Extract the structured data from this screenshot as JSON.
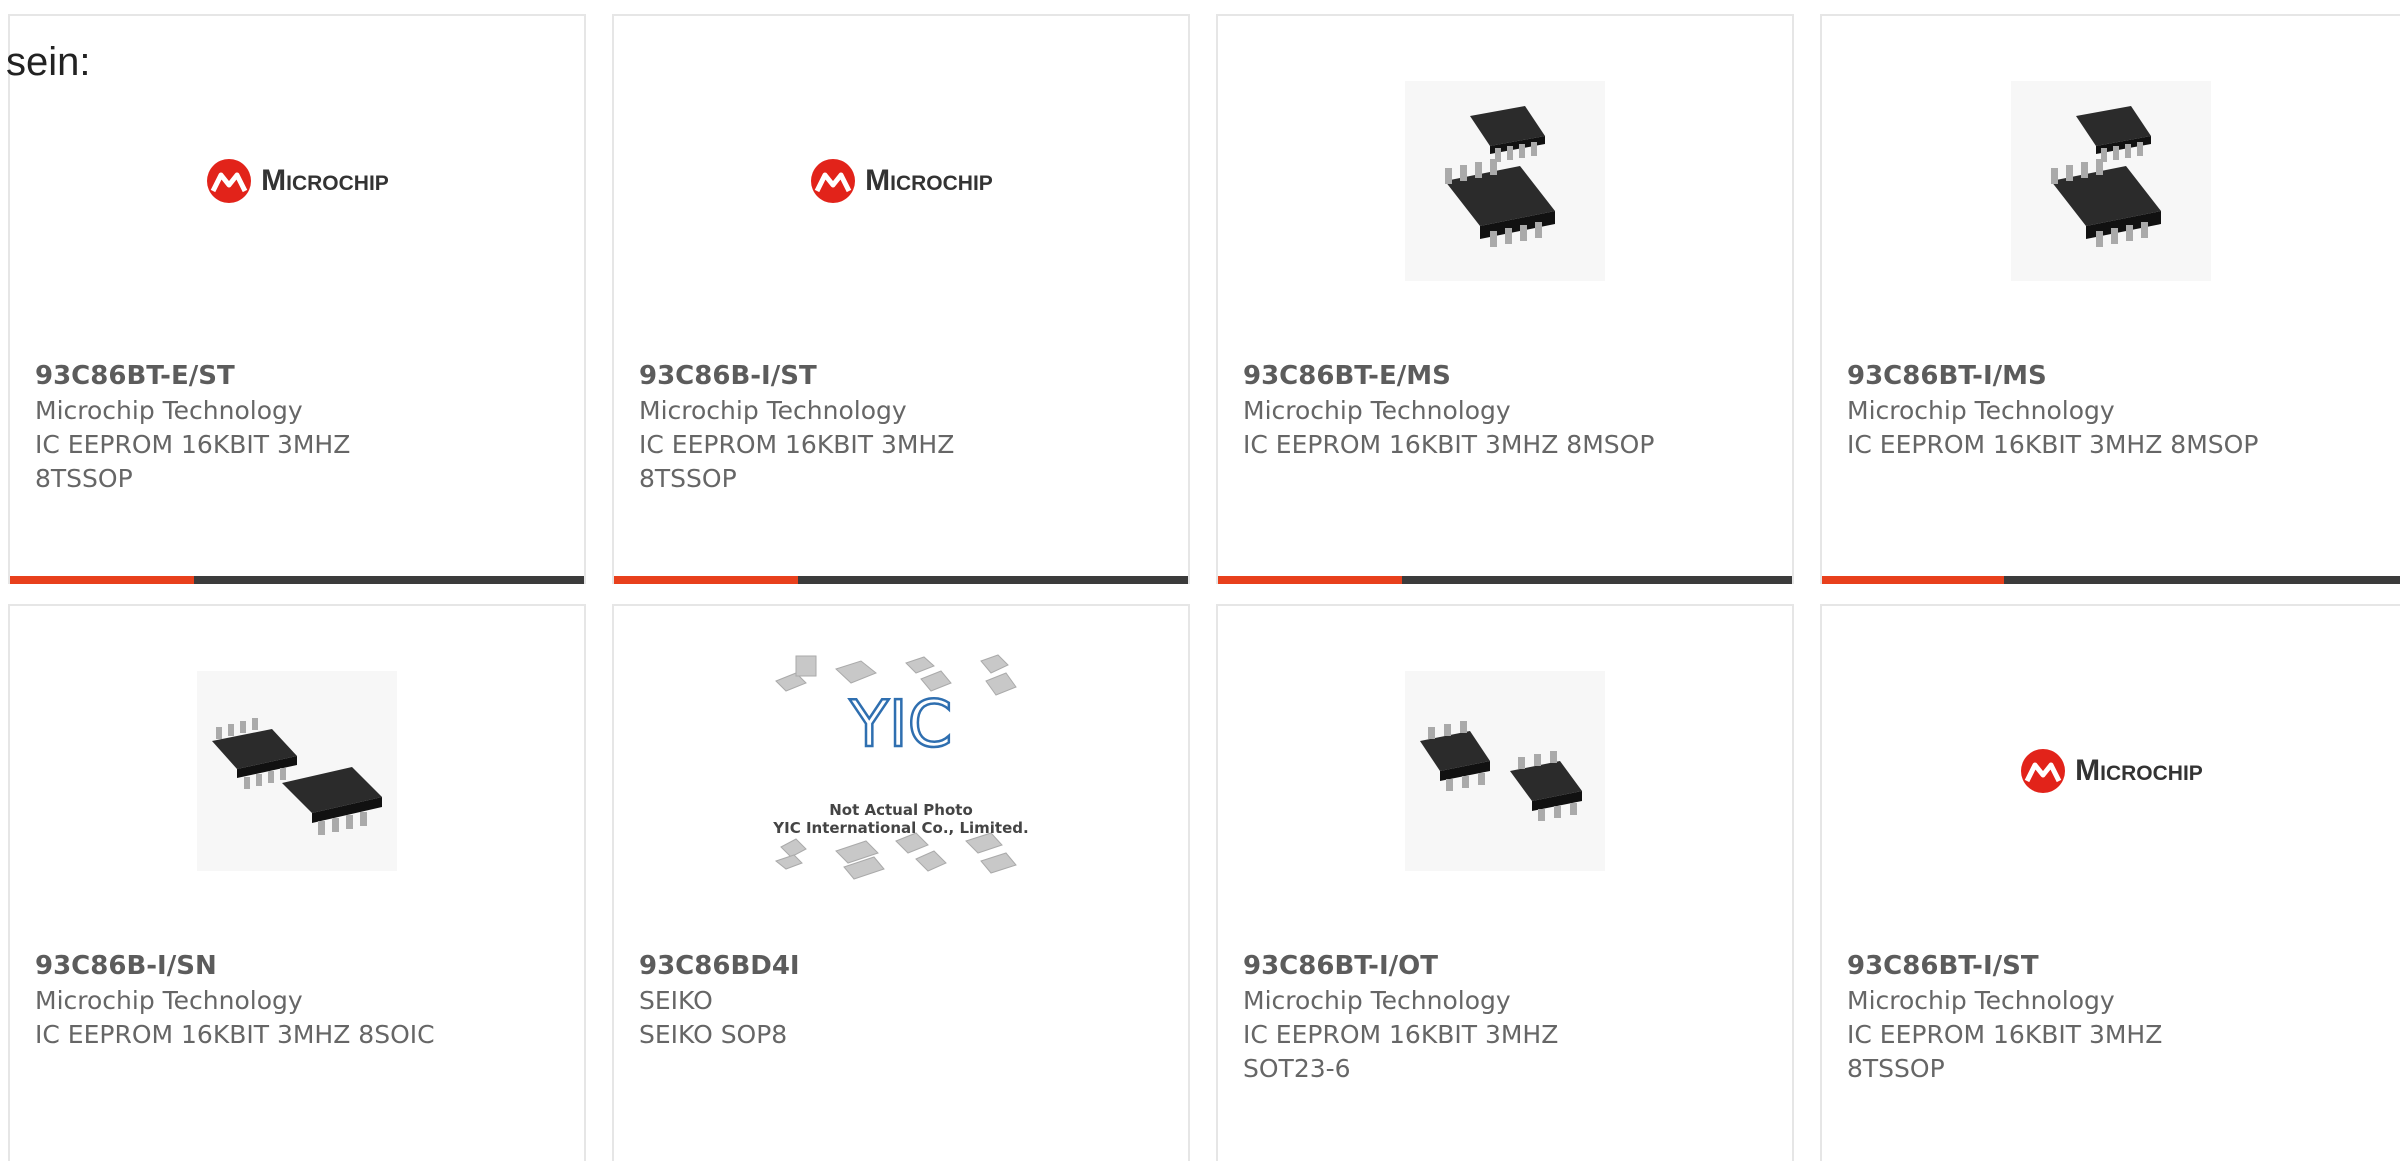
{
  "intro": "sein:",
  "logo_word": "Microchip",
  "yic_badge": {
    "caption_1": "Not Actual Photo",
    "caption_2": "YIC International Co., Limited."
  },
  "colors": {
    "accent": "#e8401c",
    "bar": "#3b3b3b",
    "text": "#666666",
    "logo_red": "#e2231a"
  },
  "cards": [
    {
      "image": "microchip-logo",
      "part": "93C86BT-E/ST",
      "maker": "Microchip Technology",
      "desc": "IC EEPROM 16KBIT 3MHZ 8TSSOP"
    },
    {
      "image": "microchip-logo",
      "part": "93C86B-I/ST",
      "maker": "Microchip Technology",
      "desc": "IC EEPROM 16KBIT 3MHZ 8TSSOP"
    },
    {
      "image": "msop-chip-photo",
      "part": "93C86BT-E/MS",
      "maker": "Microchip Technology",
      "desc": "IC EEPROM 16KBIT 3MHZ 8MSOP"
    },
    {
      "image": "msop-chip-photo",
      "part": "93C86BT-I/MS",
      "maker": "Microchip Technology",
      "desc": "IC EEPROM 16KBIT 3MHZ 8MSOP"
    },
    {
      "image": "soic-chip-photo",
      "part": "93C86B-I/SN",
      "maker": "Microchip Technology",
      "desc": "IC EEPROM 16KBIT 3MHZ 8SOIC"
    },
    {
      "image": "yic-not-actual-photo",
      "part": "93C86BD4I",
      "maker": "SEIKO",
      "desc": "SEIKO SOP8"
    },
    {
      "image": "sot23-chip-photo",
      "part": "93C86BT-I/OT",
      "maker": "Microchip Technology",
      "desc": "IC EEPROM 16KBIT 3MHZ SOT23-6"
    },
    {
      "image": "microchip-logo",
      "part": "93C86BT-I/ST",
      "maker": "Microchip Technology",
      "desc": "IC EEPROM 16KBIT 3MHZ 8TSSOP"
    }
  ]
}
